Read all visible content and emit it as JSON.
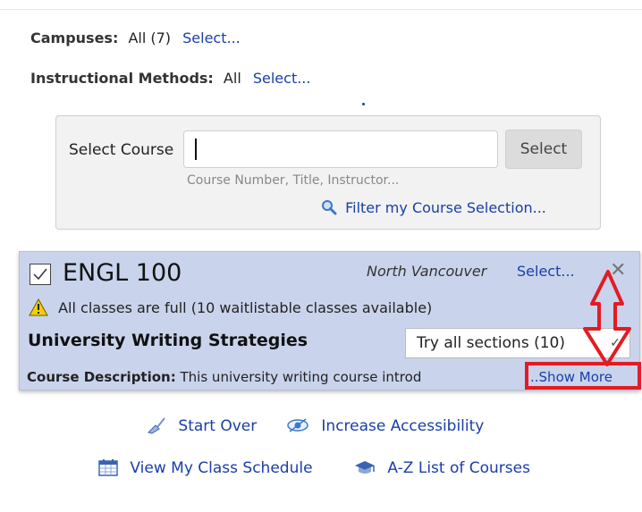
{
  "filters": {
    "campuses": {
      "label": "Campuses:",
      "value": "All (7)",
      "link": "Select..."
    },
    "instructional_methods": {
      "label": "Instructional Methods:",
      "value": "All",
      "link": "Select..."
    }
  },
  "course_select": {
    "label": "Select Course",
    "input_value": "",
    "placeholder": "Course Number, Title, Instructor...",
    "button_label": "Select",
    "filter_link": "Filter my Course Selection...",
    "filter_icon": "magnifier-icon"
  },
  "course_card": {
    "checked": true,
    "code": "ENGL 100",
    "campus": "North Vancouver",
    "campus_link": "Select...",
    "close_glyph": "✕",
    "warning": "All classes are full (10 waitlistable classes available)",
    "title": "University Writing Strategies",
    "sections_selected": "Try all sections (10)",
    "description_label": "Course Description:",
    "description_text": "This university writing course introd",
    "show_more": "..Show More"
  },
  "actions": {
    "start_over": "Start Over",
    "increase_accessibility": "Increase Accessibility",
    "view_schedule": "View My Class Schedule",
    "az_list": "A-Z List of Courses"
  },
  "colors": {
    "link": "#1a3ea8",
    "card_bg": "#c9d4ec",
    "panel_bg": "#f2f2f2",
    "annotation_red": "#e31b23",
    "warning_yellow": "#f5d000"
  }
}
